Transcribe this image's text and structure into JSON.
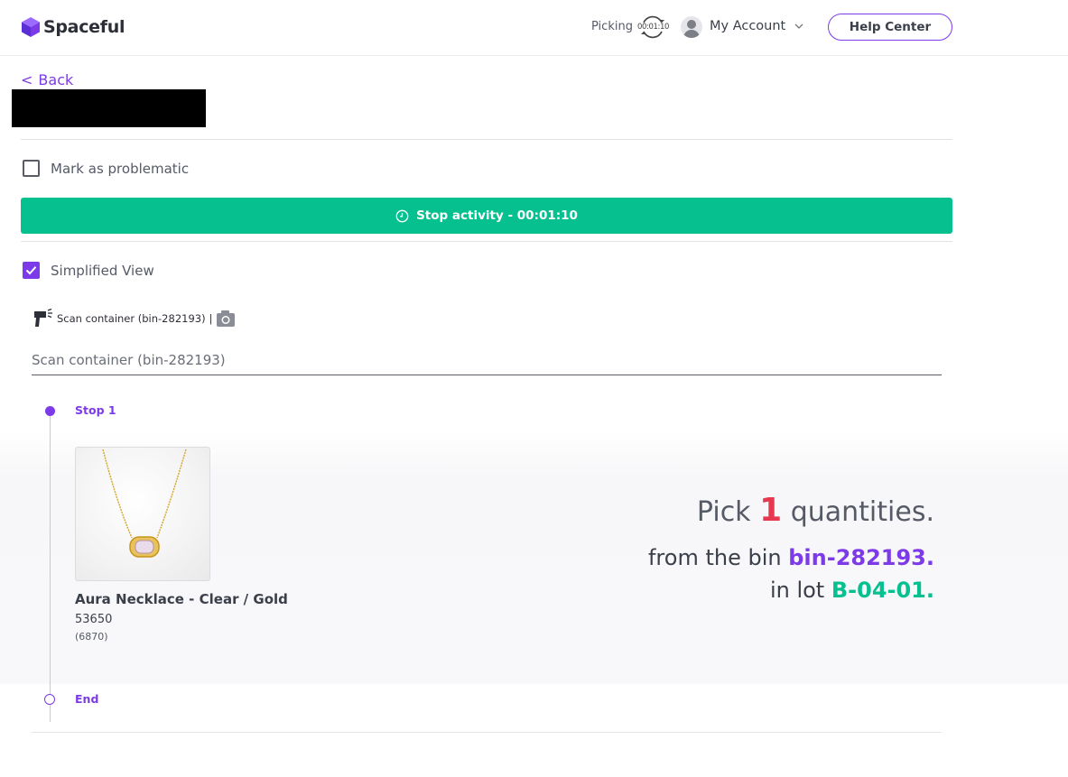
{
  "header": {
    "brand": "Spaceful",
    "activity_label": "Picking",
    "activity_timer": "00:01:10",
    "account_label": "My Account",
    "help_label": "Help Center"
  },
  "nav": {
    "back_label": "Back"
  },
  "problem": {
    "label": "Mark as problematic",
    "checked": false
  },
  "activity": {
    "stop_label": "Stop activity - 00:01:10"
  },
  "view": {
    "simplified_label": "Simplified View",
    "checked": true
  },
  "scan": {
    "prompt": "Scan container (bin-282193)",
    "separator": "|",
    "placeholder": "Scan container (bin-282193)"
  },
  "timeline": {
    "stop_label": "Stop 1",
    "end_label": "End"
  },
  "item": {
    "name": "Aura Necklace - Clear / Gold",
    "sku": "53650",
    "id": "(6870)"
  },
  "instructions": {
    "pick_prefix": "Pick",
    "quantity": "1",
    "pick_suffix": "quantities.",
    "bin_prefix": "from the bin",
    "bin": "bin-282193.",
    "lot_prefix": "in lot",
    "lot": "B-04-01."
  },
  "colors": {
    "accent": "#7d3ae8",
    "success": "#06c08f",
    "danger": "#e8384f"
  }
}
